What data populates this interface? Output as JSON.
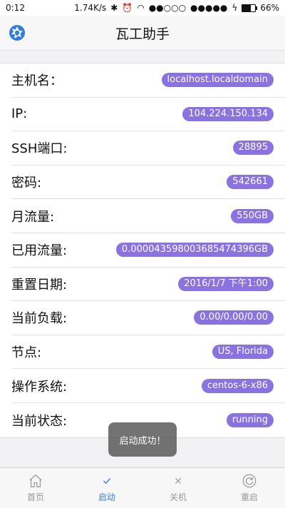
{
  "status_bar": {
    "time": "0:12",
    "net_speed": "1.74K/s",
    "signal_1": "●●○○○",
    "signal_2": "●●●●●",
    "battery": "66%",
    "battery_level": 0.66
  },
  "header": {
    "title": "瓦工助手"
  },
  "rows": [
    {
      "label": "主机名：",
      "value": "localhost.localdomain"
    },
    {
      "label": "IP:",
      "value": "104.224.150.134"
    },
    {
      "label": "SSH端口:",
      "value": "28895"
    },
    {
      "label": "密码:",
      "value": "542661"
    },
    {
      "label": "月流量:",
      "value": "550GB"
    },
    {
      "label": "已用流量:",
      "value": "0.0000435980036854743​96GB"
    },
    {
      "label": "重置日期:",
      "value": "2016/1/7 下午1:00"
    },
    {
      "label": "当前负载:",
      "value": "0.00/0.00/0.00"
    },
    {
      "label": "节点:",
      "value": "US, Florida"
    },
    {
      "label": "操作系统:",
      "value": "centos-6-x86"
    },
    {
      "label": "当前状态:",
      "value": "running"
    }
  ],
  "toast": "启动成功！",
  "tabs": [
    {
      "label": "首页",
      "icon": "home-icon"
    },
    {
      "label": "启动",
      "icon": "check-icon",
      "active": true
    },
    {
      "label": "关机",
      "icon": "close-icon"
    },
    {
      "label": "重启",
      "icon": "restart-icon"
    }
  ],
  "colors": {
    "badge": "#8a72e0",
    "active_tab": "#3b7de0",
    "inactive_tab": "#9a9a9a"
  }
}
